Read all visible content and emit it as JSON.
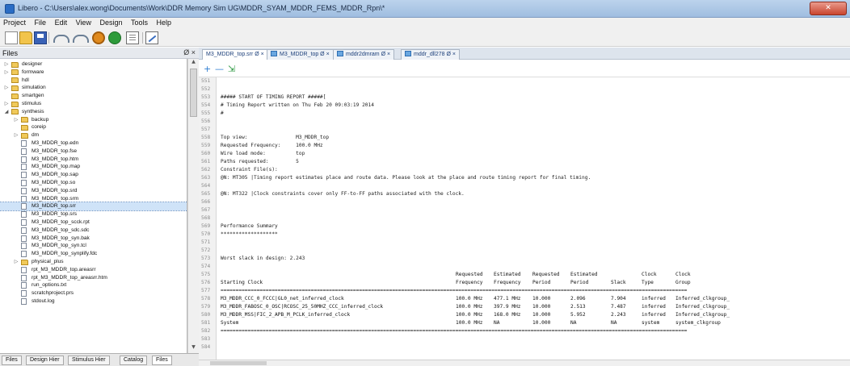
{
  "window": {
    "title": "Libero - C:\\Users\\alex.wong\\Documents\\Work\\DDR Memory Sim UG\\MDDR_SYAM_MDDR_FEMS_MDDR_Rpn\\*"
  },
  "menu": [
    "Project",
    "File",
    "Edit",
    "View",
    "Design",
    "Tools",
    "Help"
  ],
  "toolbar_icons": [
    "new-file-icon",
    "open-folder-icon",
    "save-icon",
    "undo-icon",
    "redo-icon",
    "gear-icon",
    "run-icon",
    "document-icon",
    "edit-icon"
  ],
  "files_panel": {
    "title": "Files",
    "controls": "Ø ×",
    "items": [
      {
        "label": "designer",
        "type": "folder",
        "level": 1,
        "arrow": "▷"
      },
      {
        "label": "formware",
        "type": "folder",
        "level": 1,
        "arrow": "▷"
      },
      {
        "label": "hdl",
        "type": "folder",
        "level": 1,
        "arrow": ""
      },
      {
        "label": "simulation",
        "type": "folder",
        "level": 1,
        "arrow": "▷"
      },
      {
        "label": "smartgen",
        "type": "folder",
        "level": 1,
        "arrow": ""
      },
      {
        "label": "stimulus",
        "type": "folder",
        "level": 1,
        "arrow": "▷"
      },
      {
        "label": "synthesis",
        "type": "folder",
        "level": 1,
        "arrow": "◢"
      },
      {
        "label": "backup",
        "type": "folder",
        "level": 2,
        "arrow": "▷"
      },
      {
        "label": "coreip",
        "type": "folder",
        "level": 2,
        "arrow": ""
      },
      {
        "label": "dm",
        "type": "folder",
        "level": 2,
        "arrow": "▷"
      },
      {
        "label": "M3_MDDR_top.edn",
        "type": "file",
        "level": 2,
        "arrow": ""
      },
      {
        "label": "M3_MDDR_top.fse",
        "type": "file",
        "level": 2,
        "arrow": ""
      },
      {
        "label": "M3_MDDR_top.htm",
        "type": "file",
        "level": 2,
        "arrow": ""
      },
      {
        "label": "M3_MDDR_top.map",
        "type": "file",
        "level": 2,
        "arrow": ""
      },
      {
        "label": "M3_MDDR_top.sap",
        "type": "file",
        "level": 2,
        "arrow": ""
      },
      {
        "label": "M3_MDDR_top.so",
        "type": "file",
        "level": 2,
        "arrow": ""
      },
      {
        "label": "M3_MDDR_top.srd",
        "type": "file",
        "level": 2,
        "arrow": ""
      },
      {
        "label": "M3_MDDR_top.srm",
        "type": "file",
        "level": 2,
        "arrow": ""
      },
      {
        "label": "M3_MDDR_top.srr",
        "type": "file",
        "level": 2,
        "arrow": "",
        "selected": true
      },
      {
        "label": "M3_MDDR_top.srs",
        "type": "file",
        "level": 2,
        "arrow": ""
      },
      {
        "label": "M3_MDDR_top_scck.rpt",
        "type": "file",
        "level": 2,
        "arrow": ""
      },
      {
        "label": "M3_MDDR_top_sdc.sdc",
        "type": "file",
        "level": 2,
        "arrow": ""
      },
      {
        "label": "M3_MDDR_top_syn.bak",
        "type": "file",
        "level": 2,
        "arrow": ""
      },
      {
        "label": "M3_MDDR_top_syn.tcl",
        "type": "file",
        "level": 2,
        "arrow": ""
      },
      {
        "label": "M3_MDDR_top_synplify.fdc",
        "type": "file",
        "level": 2,
        "arrow": ""
      },
      {
        "label": "physical_plus",
        "type": "folder",
        "level": 2,
        "arrow": "▷"
      },
      {
        "label": "rpt_M3_MDDR_top.areasrr",
        "type": "file",
        "level": 2,
        "arrow": ""
      },
      {
        "label": "rpt_M3_MDDR_top_areasrr.htm",
        "type": "file",
        "level": 2,
        "arrow": ""
      },
      {
        "label": "run_options.txt",
        "type": "file",
        "level": 2,
        "arrow": ""
      },
      {
        "label": "scratchproject.prs",
        "type": "file",
        "level": 2,
        "arrow": ""
      },
      {
        "label": "stdout.log",
        "type": "file",
        "level": 2,
        "arrow": ""
      }
    ]
  },
  "bottom_tabs": [
    "Files",
    "Design Hier",
    "Stimulus Hier",
    "Catalog",
    "Files"
  ],
  "doc_tabs": [
    {
      "label": "M3_MDDR_top.srr  Ø ×",
      "active": true,
      "icon": false
    },
    {
      "label": "M3_MDDR_top Ø ×",
      "active": false,
      "icon": true
    },
    {
      "label": "mddr2dmram Ø ×",
      "active": false,
      "icon": true
    },
    {
      "label": "mddr_dll278 Ø ×",
      "active": false,
      "icon": true
    }
  ],
  "editor_toolbar": {
    "plus": "+",
    "minus": "—",
    "goto": "⇲"
  },
  "editor": {
    "lines": [
      {
        "n": "551",
        "text": ""
      },
      {
        "n": "552",
        "text": ""
      },
      {
        "n": "553",
        "text": "##### START OF TIMING REPORT #####["
      },
      {
        "n": "554",
        "text": "# Timing Report written on Thu Feb 20 09:03:19 2014"
      },
      {
        "n": "555",
        "text": "#"
      },
      {
        "n": "556",
        "text": ""
      },
      {
        "n": "557",
        "text": ""
      },
      {
        "n": "558",
        "text": "Top view:                M3_MDDR_top"
      },
      {
        "n": "559",
        "text": "Requested Frequency:     100.0 MHz"
      },
      {
        "n": "560",
        "text": "Wire load mode:          top"
      },
      {
        "n": "561",
        "text": "Paths requested:         5"
      },
      {
        "n": "562",
        "text": "Constraint File(s):"
      },
      {
        "n": "563",
        "text": "@N: MT305 |Timing report estimates place and route data. Please look at the place and route timing report for final timing."
      },
      {
        "n": "564",
        "text": ""
      },
      {
        "n": "565",
        "text": "@N: MT322 |Clock constraints cover only FF-to-FF paths associated with the clock."
      },
      {
        "n": "566",
        "text": ""
      },
      {
        "n": "567",
        "text": ""
      },
      {
        "n": "568",
        "text": ""
      },
      {
        "n": "569",
        "text": "Performance Summary"
      },
      {
        "n": "570",
        "text": "*******************"
      },
      {
        "n": "571",
        "text": ""
      },
      {
        "n": "572",
        "text": ""
      },
      {
        "n": "573",
        "text": "Worst slack in design: 2.243"
      },
      {
        "n": "574",
        "text": ""
      },
      {
        "n": "575",
        "text": ""
      },
      {
        "n": "576",
        "text": ""
      },
      {
        "n": "577",
        "text": ""
      },
      {
        "n": "578",
        "text": ""
      },
      {
        "n": "579",
        "text": ""
      },
      {
        "n": "580",
        "text": ""
      },
      {
        "n": "581",
        "text": ""
      },
      {
        "n": "582",
        "text": ""
      },
      {
        "n": "583",
        "text": ""
      },
      {
        "n": "584",
        "text": ""
      }
    ],
    "table": {
      "header1": [
        "",
        "Requested",
        "Estimated",
        "Requested",
        "Estimated",
        "",
        "Clock",
        "Clock"
      ],
      "header2": [
        "Starting Clock",
        "Frequency",
        "Frequency",
        "Period",
        "Period",
        "Slack",
        "Type",
        "Group"
      ],
      "separator": "===========================================================================================================================================================",
      "rows": [
        [
          "M3_MDDR_CCC_0_FCCC|GL0_net_inferred_clock",
          "100.0 MHz",
          "477.1 MHz",
          "10.000",
          "2.096",
          "7.904",
          "inferred",
          "Inferred_clkgroup_"
        ],
        [
          "M3_MDDR_FABOSC_0_OSC|RCOSC_25_50MHZ_CCC_inferred_clock",
          "100.0 MHz",
          "397.9 MHz",
          "10.000",
          "2.513",
          "7.487",
          "inferred",
          "Inferred_clkgroup_"
        ],
        [
          "M3_MDDR_MSS|FIC_2_APB_M_PCLK_inferred_clock",
          "100.0 MHz",
          "168.0 MHz",
          "10.000",
          "5.952",
          "2.243",
          "inferred",
          "Inferred_clkgroup_"
        ],
        [
          "System",
          "100.0 MHz",
          "NA",
          "10.000",
          "NA",
          "NA",
          "system",
          "system_clkgroup"
        ]
      ]
    }
  }
}
